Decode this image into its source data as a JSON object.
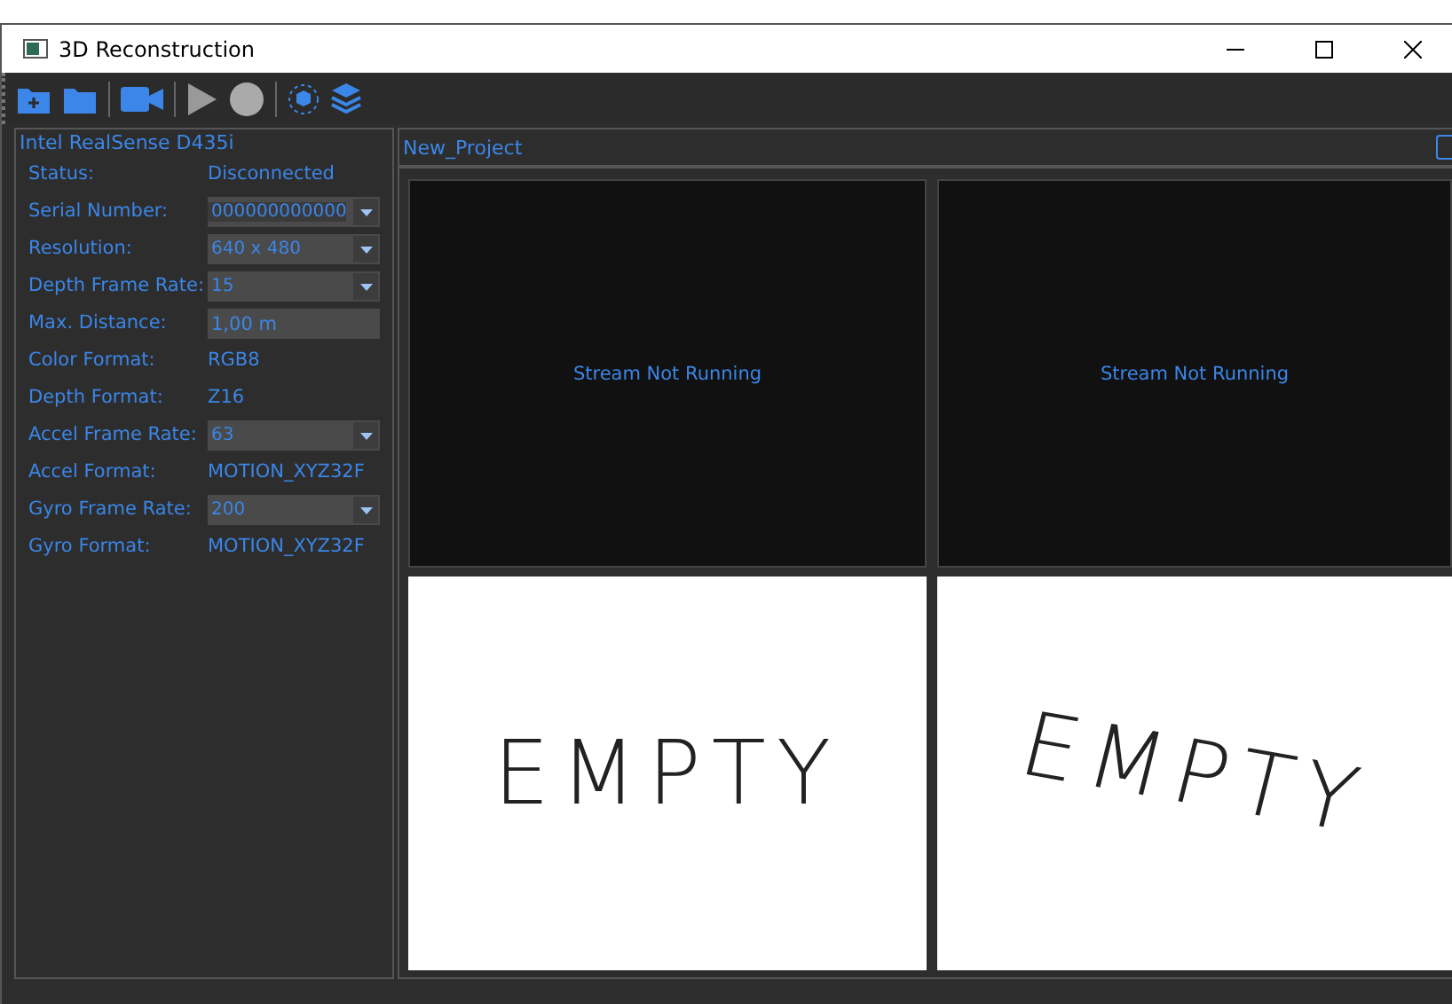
{
  "window": {
    "title": "3D Reconstruction"
  },
  "toolbar": [
    {
      "kind": "new-folder"
    },
    {
      "kind": "folder"
    },
    {
      "kind": "camera"
    },
    {
      "kind": "play"
    },
    {
      "kind": "record"
    },
    {
      "kind": "cube"
    },
    {
      "kind": "layers"
    }
  ],
  "device": {
    "title": "Intel RealSense D435i",
    "fields": [
      {
        "label": "Status:",
        "kind": "text",
        "value": "Disconnected"
      },
      {
        "label": "Serial Number:",
        "kind": "combo",
        "value": "000000000000",
        "selected": true
      },
      {
        "label": "Resolution:",
        "kind": "combo",
        "value": "640 x 480",
        "selected": false
      },
      {
        "label": "Depth Frame Rate:",
        "kind": "combo",
        "value": "15",
        "selected": false
      },
      {
        "label": "Max. Distance:",
        "kind": "input",
        "value": "1,00 m"
      },
      {
        "label": "Color Format:",
        "kind": "text",
        "value": "RGB8"
      },
      {
        "label": "Depth Format:",
        "kind": "text",
        "value": "Z16"
      },
      {
        "label": "Accel Frame Rate:",
        "kind": "combo",
        "value": "63",
        "selected": false
      },
      {
        "label": "Accel Format:",
        "kind": "text",
        "value": "MOTION_XYZ32F"
      },
      {
        "label": "Gyro Frame Rate:",
        "kind": "combo",
        "value": "200",
        "selected": false
      },
      {
        "label": "Gyro Format:",
        "kind": "text",
        "value": "MOTION_XYZ32F"
      }
    ]
  },
  "project": {
    "title": "New_Project",
    "views": [
      {
        "kind": "stream",
        "text": "Stream Not Running"
      },
      {
        "kind": "stream",
        "text": "Stream Not Running"
      },
      {
        "kind": "empty",
        "text": "EMPTY",
        "tilted": false
      },
      {
        "kind": "empty",
        "text": "EMPTY",
        "tilted": true
      }
    ]
  }
}
